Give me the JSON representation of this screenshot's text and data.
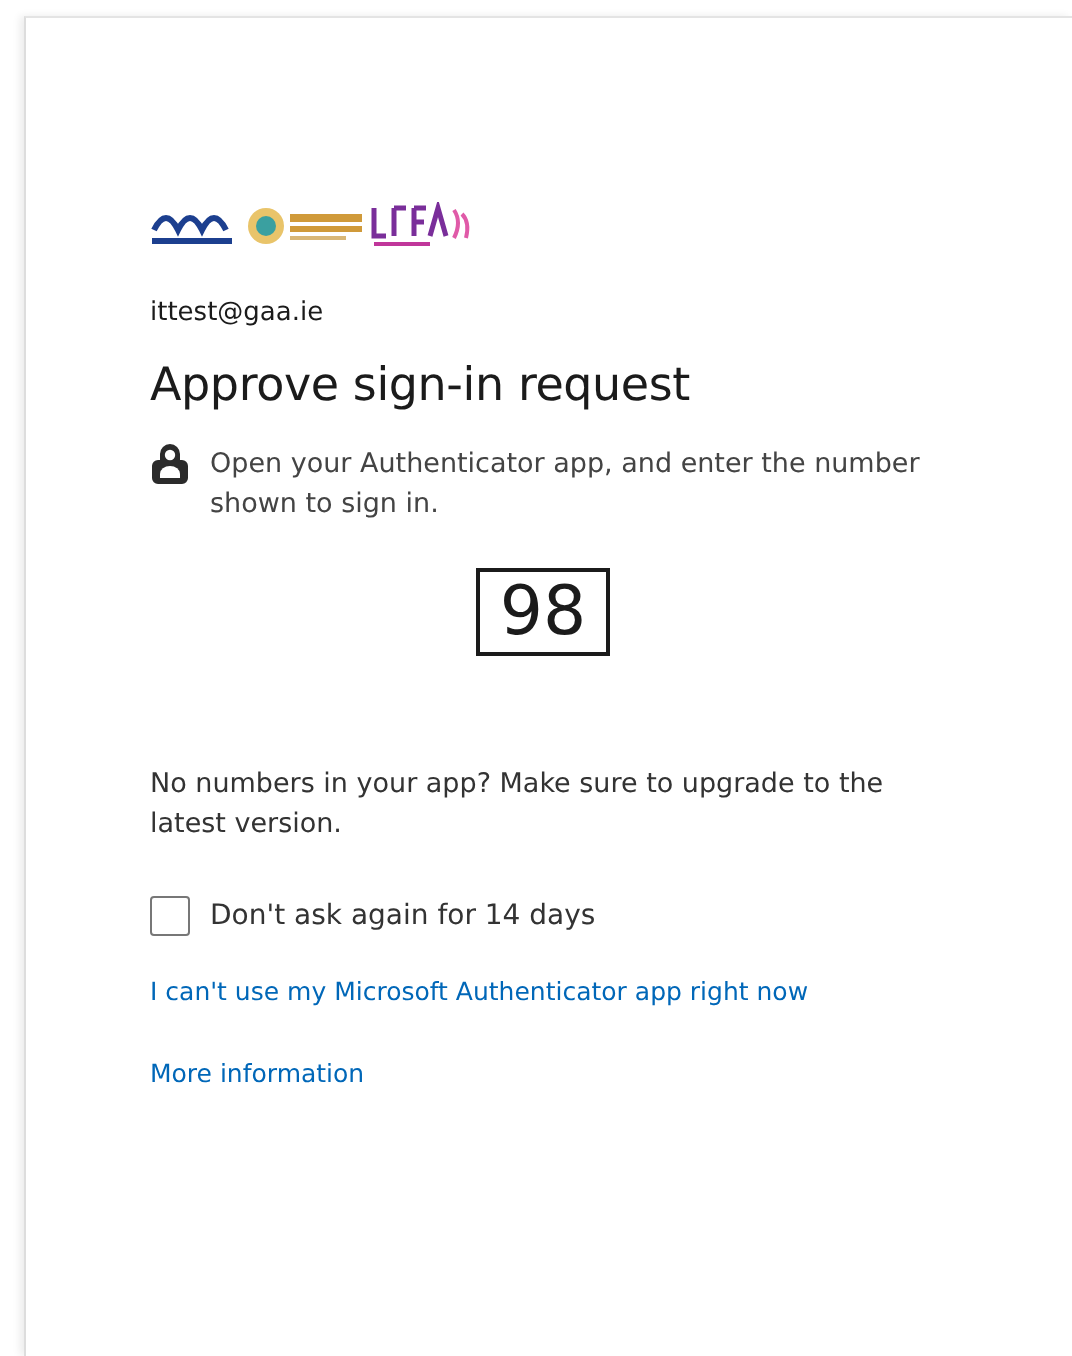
{
  "account": {
    "email": "ittest@gaa.ie"
  },
  "title": "Approve sign-in request",
  "instruction": "Open your Authenticator app, and enter the number shown to sign in.",
  "number": "98",
  "note": "No numbers in your app? Make sure to upgrade to the latest version.",
  "remember": {
    "label": "Don't ask again for 14 days",
    "checked": false
  },
  "links": [
    "I can't use my Microsoft Authenticator app right now",
    "More information"
  ]
}
